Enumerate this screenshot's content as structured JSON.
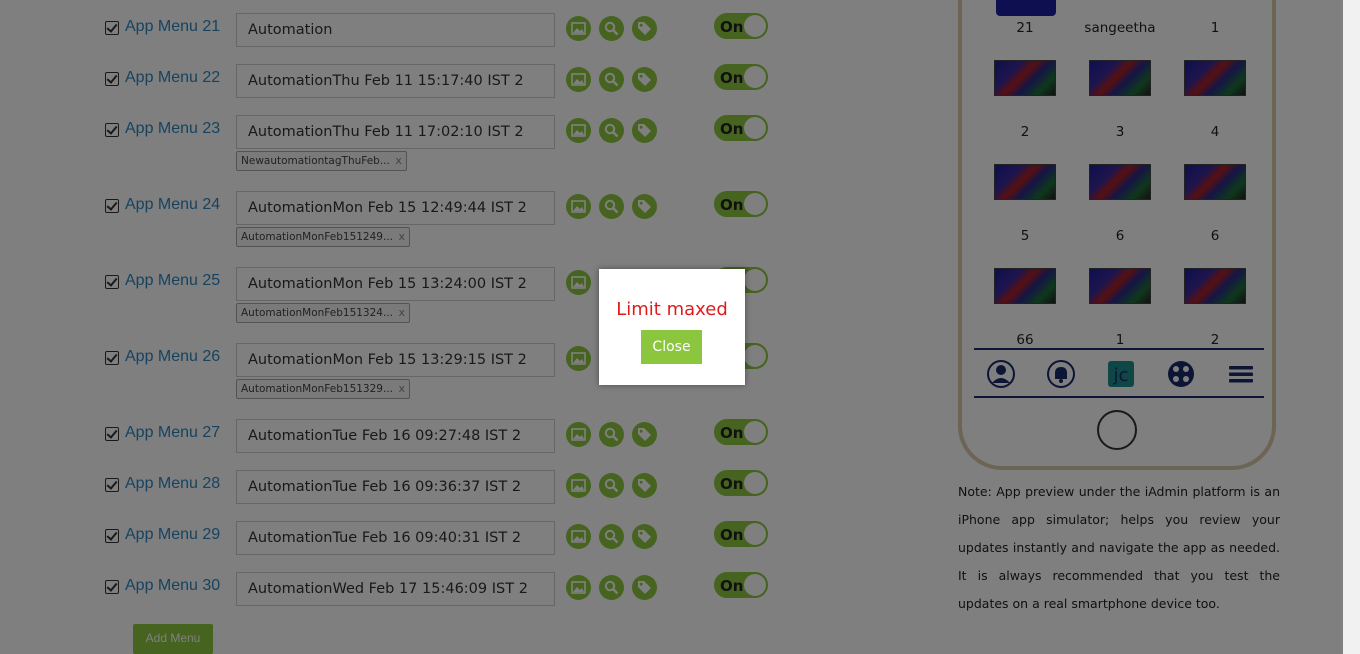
{
  "menu_rows": [
    {
      "label": "App Menu 21",
      "value": "Automation",
      "tag": "",
      "toggle": "On"
    },
    {
      "label": "App Menu 22",
      "value": "AutomationThu Feb 11 15:17:40 IST 2",
      "tag": "",
      "toggle": "On"
    },
    {
      "label": "App Menu 23",
      "value": "AutomationThu Feb 11 17:02:10 IST 2",
      "tag": "NewautomationtagThuFeb...",
      "tag_remove": "x",
      "toggle": "On"
    },
    {
      "label": "App Menu 24",
      "value": "AutomationMon Feb 15 12:49:44 IST 2",
      "tag": "AutomationMonFeb151249...",
      "tag_remove": "x",
      "toggle": "On"
    },
    {
      "label": "App Menu 25",
      "value": "AutomationMon Feb 15 13:24:00 IST 2",
      "tag": "AutomationMonFeb151324...",
      "tag_remove": "x",
      "toggle": "On"
    },
    {
      "label": "App Menu 26",
      "value": "AutomationMon Feb 15 13:29:15 IST 2",
      "tag": "AutomationMonFeb151329...",
      "tag_remove": "x",
      "toggle": "On"
    },
    {
      "label": "App Menu 27",
      "value": "AutomationTue Feb 16 09:27:48 IST 2",
      "tag": "",
      "toggle": "On"
    },
    {
      "label": "App Menu 28",
      "value": "AutomationTue Feb 16 09:36:37 IST 2",
      "tag": "",
      "toggle": "On"
    },
    {
      "label": "App Menu 29",
      "value": "AutomationTue Feb 16 09:40:31 IST 2",
      "tag": "",
      "toggle": "On"
    },
    {
      "label": "App Menu 30",
      "value": "AutomationWed Feb 17 15:46:09 IST 2",
      "tag": "",
      "toggle": "On"
    }
  ],
  "row_icons": [
    "image-icon",
    "search-icon",
    "tag-icon"
  ],
  "add_menu_label": "Add Menu",
  "phone": {
    "grid_labels": [
      "21",
      "sangeetha",
      "1",
      "2",
      "3",
      "4",
      "5",
      "6",
      "6",
      "66",
      "1",
      "2"
    ],
    "tab_icons": [
      "profile-icon",
      "notification-bell-icon",
      "app-logo-icon",
      "film-reel-icon",
      "hamburger-menu-icon"
    ]
  },
  "note": "Note: App preview under the iAdmin platform is an iPhone app simulator; helps you review your updates instantly and navigate the app as needed. It is always recommended that you test the updates on a real smartphone device too.",
  "dialog": {
    "message": "Limit maxed",
    "close_label": "Close"
  },
  "colors": {
    "accent_green": "#8cc63f",
    "link_blue": "#2e86c1",
    "error_red": "#e01b1b",
    "phone_navy": "#1b2a6b"
  }
}
